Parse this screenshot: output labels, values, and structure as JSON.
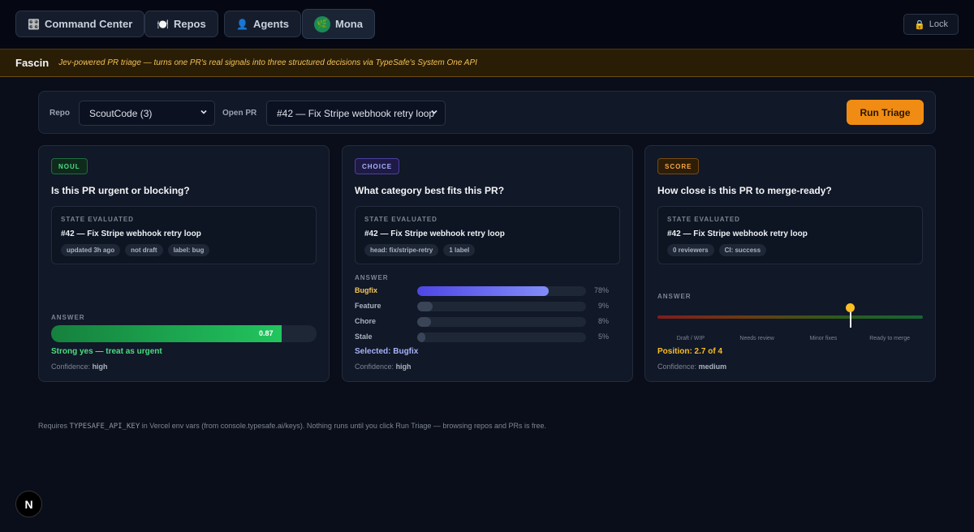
{
  "nav": {
    "items": [
      {
        "icon": "🎛️",
        "label": "Command Center"
      },
      {
        "icon": "🍽️",
        "label": "Repos"
      },
      {
        "icon": "👤",
        "label": "Agents"
      },
      {
        "icon": "🌿",
        "label": "Mona"
      }
    ],
    "lock": {
      "icon": "🔒",
      "label": "Lock"
    }
  },
  "banner": {
    "brand": "Fascin",
    "tagline": "Jev-powered PR triage — turns one PR's real signals into three structured decisions via TypeSafe's System One API"
  },
  "controls": {
    "repo_label": "Repo",
    "repo_value": "ScoutCode (3)",
    "pr_label": "Open PR",
    "pr_value": "#42 — Fix Stripe webhook retry loop",
    "run_label": "Run Triage",
    "accent": "#f08c13"
  },
  "cards": [
    {
      "badge": "NOUL",
      "question": "Is this PR urgent or blocking?",
      "state_label": "STATE EVALUATED",
      "state_title": "#42 — Fix Stripe webhook retry loop",
      "chips": [
        "updated 3h ago",
        "not draft",
        "label: bug"
      ],
      "answer_label": "ANSWER",
      "value": 0.87,
      "value_text": "0.87",
      "result": "Strong yes — treat as urgent",
      "confidence_label": "Confidence:",
      "confidence": "high"
    },
    {
      "badge": "CHOICE",
      "question": "What category best fits this PR?",
      "state_label": "STATE EVALUATED",
      "state_title": "#42 — Fix Stripe webhook retry loop",
      "chips": [
        "head: fix/stripe-retry",
        "1 label"
      ],
      "answer_label": "ANSWER",
      "options": [
        {
          "name": "Bugfix",
          "pct": 78,
          "pct_text": "78%"
        },
        {
          "name": "Feature",
          "pct": 9,
          "pct_text": "9%"
        },
        {
          "name": "Chore",
          "pct": 8,
          "pct_text": "8%"
        },
        {
          "name": "Stale",
          "pct": 5,
          "pct_text": "5%"
        }
      ],
      "result": "Selected: Bugfix",
      "confidence_label": "Confidence:",
      "confidence": "high"
    },
    {
      "badge": "SCORE",
      "question": "How close is this PR to merge-ready?",
      "state_label": "STATE EVALUATED",
      "state_title": "#42 — Fix Stripe webhook retry loop",
      "chips": [
        "0 reviewers",
        "CI: success"
      ],
      "answer_label": "ANSWER",
      "scale_labels": [
        "Draft / WIP",
        "Needs review",
        "Minor fixes",
        "Ready to merge"
      ],
      "position": 2.7,
      "scale_max": 4,
      "result": "Position: 2.7 of 4",
      "confidence_label": "Confidence:",
      "confidence": "medium"
    }
  ],
  "footer": {
    "pre": "Requires",
    "env_var": "TYPESAFE_API_KEY",
    "post": "in Vercel env vars (from console.typesafe.ai/keys). Nothing runs until you click Run Triage — browsing repos and PRs is free."
  },
  "next_badge": "N"
}
